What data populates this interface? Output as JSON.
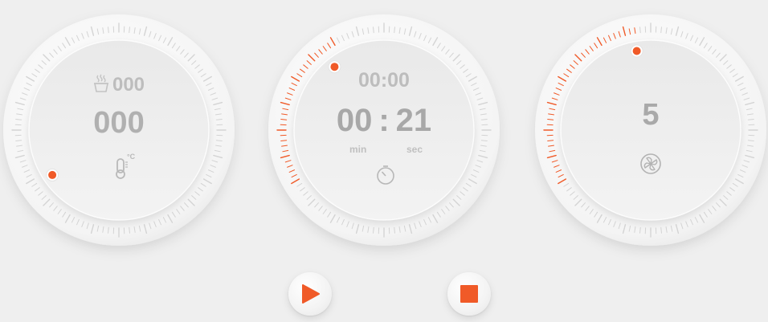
{
  "temperature_dial": {
    "weight_value": "000",
    "temperature_value": "000",
    "unit": "°C",
    "icons": [
      "steaming-cup-icon",
      "thermometer-icon"
    ]
  },
  "timer_dial": {
    "set_time": "00:00",
    "minutes": "00",
    "colon": ":",
    "seconds": "21",
    "min_label": "min",
    "sec_label": "sec",
    "icon": "timer-icon"
  },
  "speed_dial": {
    "speed_value": "5",
    "icon": "fan-blade-icon"
  },
  "controls": {
    "play_icon": "play-icon",
    "stop_icon": "stop-icon"
  },
  "colors": {
    "accent": "#f05a28",
    "background": "#efefef",
    "text": "#b0b0b0",
    "tick": "#d4d4d4"
  }
}
